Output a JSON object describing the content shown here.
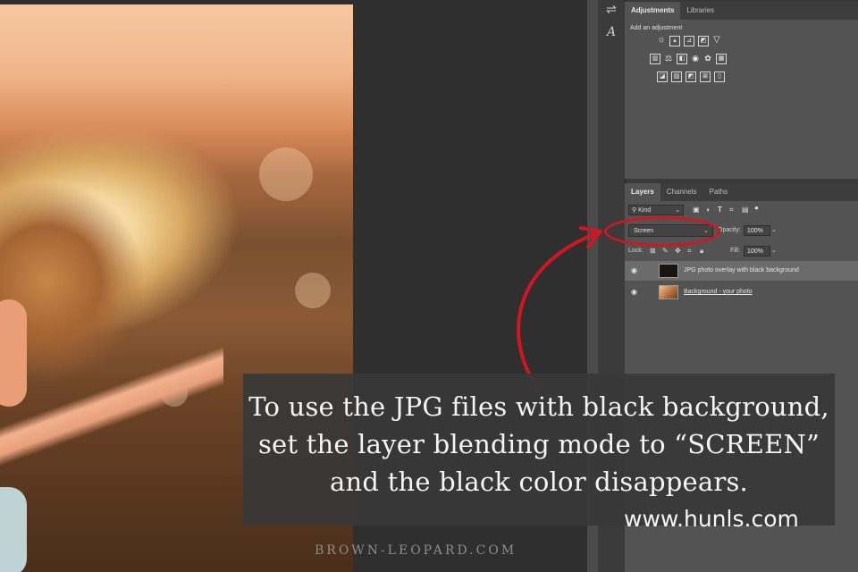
{
  "caption": {
    "line1": "To use the JPG files with black background,",
    "line2": "set the layer blending mode to “SCREEN”",
    "line3": "and the black color disappears."
  },
  "watermark": "www.hunls.com",
  "footer": "BROWN-LEOPARD.COM",
  "accent_color": "#d11622",
  "adjustments_panel": {
    "tabs": [
      "Adjustments",
      "Libraries"
    ],
    "caption": "Add an adjustment"
  },
  "layers_panel": {
    "tabs": [
      "Layers",
      "Channels",
      "Paths"
    ],
    "kind_filter": "Kind",
    "blend_mode": "Screen",
    "opacity_label": "Opacity:",
    "opacity_value": "100%",
    "lock_label": "Lock:",
    "fill_label": "Fill:",
    "fill_value": "100%",
    "layers": [
      {
        "name": "JPG photo overlay with black background",
        "selected": true
      },
      {
        "name": "Background - your photo",
        "selected": false
      }
    ]
  },
  "icons": {
    "tools": [
      "sliders-icon",
      "character-icon"
    ],
    "adjust_row1": [
      "brightness-icon",
      "levels-icon",
      "curves-icon",
      "exposure-icon",
      "vibrance-icon"
    ],
    "adjust_row2": [
      "hue-saturation-icon",
      "color-balance-icon",
      "black-white-icon",
      "photo-filter-icon",
      "channel-mixer-icon",
      "color-lookup-icon"
    ],
    "adjust_row3": [
      "invert-icon",
      "posterize-icon",
      "threshold-icon",
      "selective-color-icon",
      "gradient-map-icon"
    ],
    "layer_filters": [
      "pixel-filter-icon",
      "adjustment-filter-icon",
      "type-filter-icon",
      "shape-filter-icon",
      "smart-object-filter-icon",
      "filter-toggle-icon"
    ],
    "locks": [
      "lock-transparent-icon",
      "lock-image-icon",
      "lock-position-icon",
      "lock-artboard-icon",
      "lock-all-icon"
    ]
  }
}
